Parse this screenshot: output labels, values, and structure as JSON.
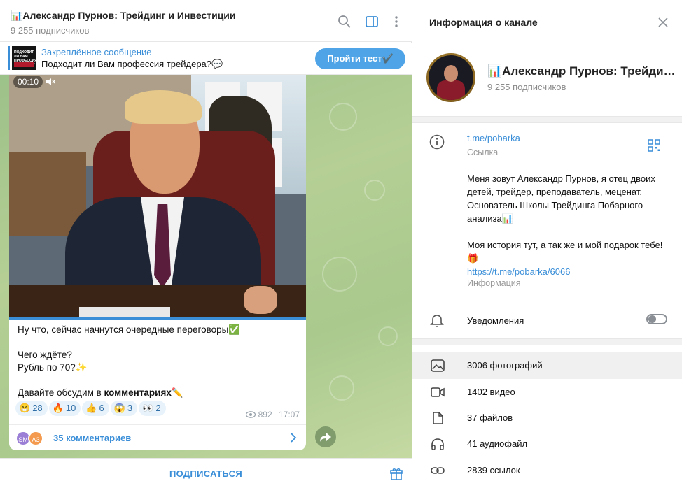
{
  "chat": {
    "title": "📊Александр Пурнов: Трейдинг и Инвестиции",
    "subscribers": "9 255 подписчиков"
  },
  "pinned": {
    "label": "Закреплённое сообщение",
    "text": "Подходит ли Вам профессия трейдера?💬",
    "button": "Пройти тест✔️",
    "thumb_text": "ПОДХОДИТ ЛИ ВАМ ПРОФЕССИЯ ТРЕЙДЕРА?"
  },
  "message": {
    "video_time": "00:10",
    "lines": [
      "Ну что, сейчас начнутся очередные переговоры✅",
      "Чего ждёте?",
      "Рубль по 70?✨",
      "Давайте обсудим в "
    ],
    "comments_word": "комментариях",
    "pencil": "✏️",
    "reactions": [
      {
        "emoji": "😁",
        "count": "28"
      },
      {
        "emoji": "🔥",
        "count": "10"
      },
      {
        "emoji": "👍",
        "count": "6"
      },
      {
        "emoji": "😱",
        "count": "3"
      },
      {
        "emoji": "👀",
        "count": "2"
      }
    ],
    "views": "892",
    "time": "17:07",
    "comments_label": "35 комментариев",
    "avatars": [
      {
        "initials": "SM",
        "color": "#9b7fd6"
      },
      {
        "initials": "АЗ",
        "color": "#f39a4f"
      }
    ]
  },
  "bottom": {
    "subscribe": "ПОДПИСАТЬСЯ"
  },
  "info_panel": {
    "title": "Информация о канале",
    "name": "📊Александр Пурнов: Трейдинг и Инвестиции",
    "subscribers": "9 255 подписчиков",
    "link": "t.me/pobarka",
    "link_caption": "Ссылка",
    "description_p1": "Меня зовут Александр Пурнов, я отец  двоих детей, трейдер, преподаватель, меценат. Основатель Школы Трейдинга Побарного анализа📊",
    "description_p2": "Моя история тут, а так же и мой подарок тебе!🎁",
    "description_link": "https://t.me/pobarka/6066",
    "description_caption": "Информация",
    "notifications": "Уведомления",
    "notifications_on": false,
    "media": [
      {
        "icon": "photo-icon",
        "label": "3006 фотографий"
      },
      {
        "icon": "video-icon",
        "label": "1402 видео"
      },
      {
        "icon": "file-icon",
        "label": "37 файлов"
      },
      {
        "icon": "headphones-icon",
        "label": "41 аудиофайл"
      },
      {
        "icon": "link-icon",
        "label": "2839 ссылок"
      }
    ]
  },
  "colors": {
    "accent": "#3a8ed8",
    "button": "#4ea4e6",
    "chat_background": "#a9c98d"
  }
}
